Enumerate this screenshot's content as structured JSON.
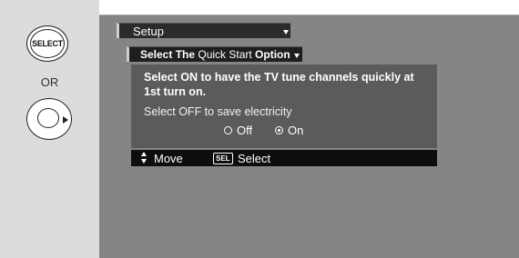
{
  "remote": {
    "select_button_label": "SELECT",
    "or_label": "OR",
    "nav_icon": "right-arrow-circle-icon"
  },
  "menu": {
    "setup_label": "Setup",
    "option_prefix": "Select The ",
    "option_name": "Quick Start",
    "option_suffix": " Option"
  },
  "dialog": {
    "message_on": "Select ON to have the TV tune channels quickly at 1st turn on.",
    "message_off": "Select OFF to save electricity",
    "options": [
      {
        "label": "Off",
        "selected": false
      },
      {
        "label": "On",
        "selected": true
      }
    ]
  },
  "footer": {
    "move_icon": "up-down-arrows-icon",
    "move_label": "Move",
    "sel_icon_text": "SEL",
    "select_label": "Select"
  },
  "colors": {
    "screen_bg": "#858585",
    "dialog_bg": "#5b5b5b",
    "footer_bg": "#0e0e0e",
    "left_panel_bg": "#dcdcdc"
  }
}
